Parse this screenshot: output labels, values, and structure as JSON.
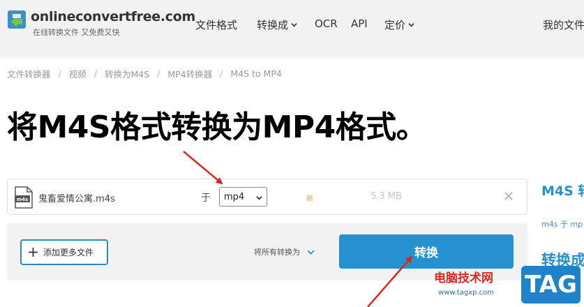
{
  "header": {
    "logo_name": "onlineconvertfree.com",
    "logo_tagline": "在线转换文件 又免费又快",
    "nav": [
      {
        "label": "文件格式",
        "has_dropdown": false
      },
      {
        "label": "转换成",
        "has_dropdown": true
      },
      {
        "label": "OCR",
        "has_dropdown": false
      },
      {
        "label": "API",
        "has_dropdown": false
      },
      {
        "label": "定价",
        "has_dropdown": true
      }
    ],
    "account_label": "我的文件"
  },
  "breadcrumb": [
    "文件转换器",
    "视频",
    "转换为M4S",
    "MP4转换器",
    "M4S to MP4"
  ],
  "page_title": "将M4S格式转换为MP4格式。",
  "file_row": {
    "file_ext_label": "m4s",
    "file_name": "鬼畜爱情公寓.m4s",
    "to_label": "于",
    "selected_format": "mp4",
    "status_badge": "新",
    "file_size": "5.3 MB"
  },
  "actions": {
    "add_files_label": "添加更多文件",
    "convert_all_label": "将所有转换为",
    "convert_label": "转换"
  },
  "sidebar": {
    "heading": "M4S 转",
    "text": "m4s 于 mp",
    "heading2": "转换成"
  },
  "watermark": {
    "text": "电脑技术网",
    "url": "www.tagxp.com",
    "tag": "TAG"
  },
  "colors": {
    "accent": "#2592cf",
    "header_bg": "#f2f2f2",
    "annotation_arrow": "#d42a1f"
  }
}
